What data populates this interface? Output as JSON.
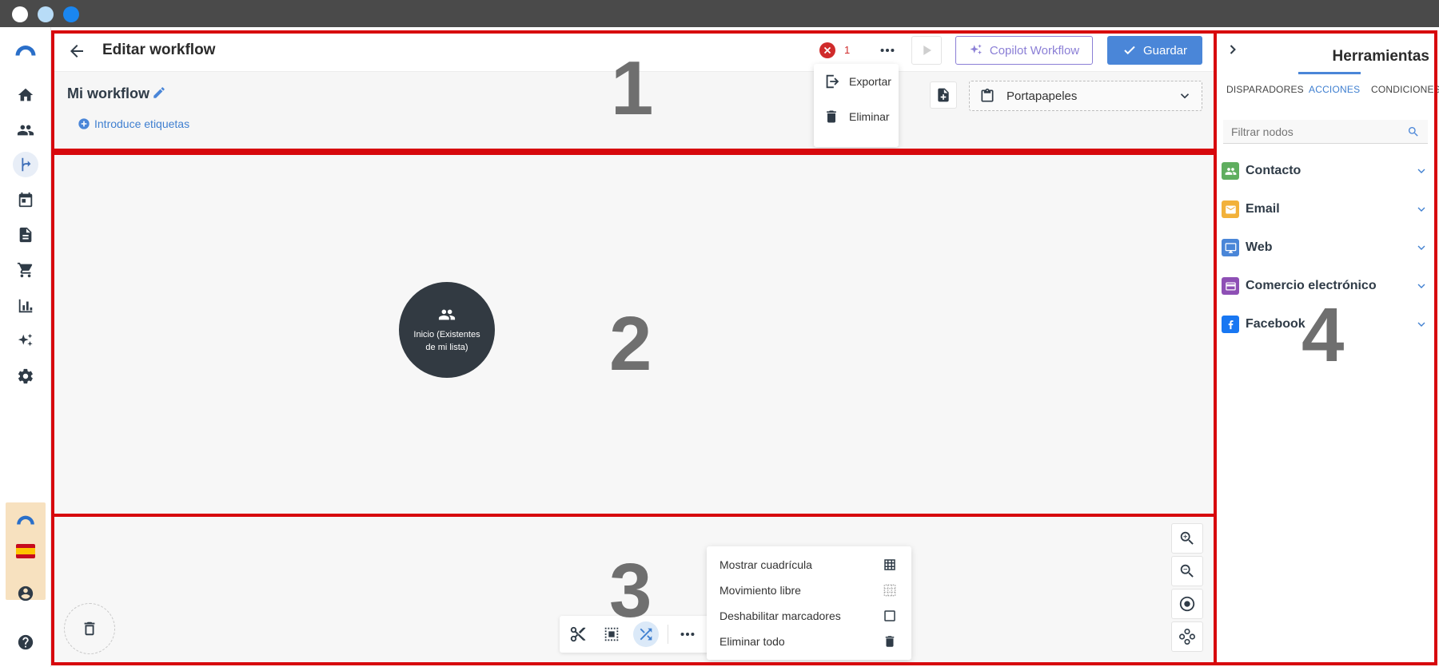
{
  "header": {
    "title": "Editar workflow",
    "error_count": "1",
    "copilot_label": "Copilot Workflow",
    "save_label": "Guardar"
  },
  "workflow": {
    "name": "Mi workflow",
    "tags_label": "Introduce etiquetas",
    "clipboard_label": "Portapapeles"
  },
  "more_menu": {
    "items": [
      {
        "label": "Exportar",
        "icon": "export-icon"
      },
      {
        "label": "Eliminar",
        "icon": "trash-icon"
      }
    ]
  },
  "canvas": {
    "start_node_label": "Inicio (Existentes de mi lista)",
    "start_node_icon": "group-icon"
  },
  "toolbar_menu": {
    "items": [
      {
        "label": "Mostrar cuadrícula",
        "icon": "grid-icon"
      },
      {
        "label": "Movimiento libre",
        "icon": "grid-dotted-icon"
      },
      {
        "label": "Deshabilitar marcadores",
        "icon": "checkbox-icon"
      },
      {
        "label": "Eliminar todo",
        "icon": "trash-icon"
      }
    ]
  },
  "tools_panel": {
    "title": "Herramientas",
    "tabs": [
      {
        "label": "DISPARADORES"
      },
      {
        "label": "ACCIONES",
        "active": true
      },
      {
        "label": "CONDICIONES"
      }
    ],
    "filter_placeholder": "Filtrar nodos",
    "categories": [
      {
        "label": "Contacto",
        "color": "#5fae5f",
        "icon": "group-icon"
      },
      {
        "label": "Email",
        "color": "#f2b13a",
        "icon": "envelope-icon"
      },
      {
        "label": "Web",
        "color": "#4a86d8",
        "icon": "monitor-icon"
      },
      {
        "label": "Comercio electrónico",
        "color": "#8e4fb5",
        "icon": "credit-card-icon"
      },
      {
        "label": "Facebook",
        "color": "#1877f2",
        "icon": "facebook-icon"
      }
    ]
  },
  "regions": {
    "r1": "1",
    "r2": "2",
    "r3": "3",
    "r4": "4"
  },
  "colors": {
    "accent": "#4a86d8",
    "region_border": "#d7080d",
    "copilot": "#8b7fd6",
    "error": "#d02b2b"
  }
}
